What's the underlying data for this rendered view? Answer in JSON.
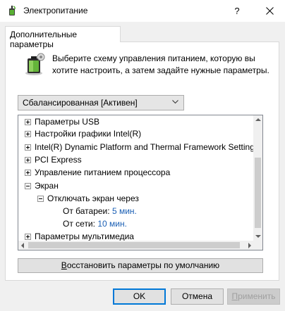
{
  "window": {
    "title": "Электропитание",
    "help_label": "?",
    "close_label": "✕",
    "icon": "power-options-icon"
  },
  "tab": {
    "label": "Дополнительные параметры"
  },
  "description": "Выберите схему управления питанием, которую вы хотите настроить, а затем задайте нужные параметры.",
  "scheme_select": {
    "selected": "Сбалансированная [Активен]"
  },
  "tree": {
    "items": [
      {
        "label": "Параметры USB",
        "expander": "plus"
      },
      {
        "label": "Настройки графики Intel(R)",
        "expander": "plus"
      },
      {
        "label": "Intel(R) Dynamic Platform and Thermal Framework Setting",
        "expander": "plus"
      },
      {
        "label": "PCI Express",
        "expander": "plus"
      },
      {
        "label": "Управление питанием процессора",
        "expander": "plus"
      },
      {
        "label": "Экран",
        "expander": "minus"
      },
      {
        "label": "Отключать экран через",
        "expander": "minus"
      },
      {
        "label": "От батареи:",
        "value": "5 мин."
      },
      {
        "label": "От сети:",
        "value": "10 мин."
      },
      {
        "label": "Параметры мультимедиа",
        "expander": "plus"
      }
    ]
  },
  "restore_button": {
    "label_underlined": "В",
    "label_rest": "осстановить параметры по умолчанию"
  },
  "buttons": {
    "ok": "OK",
    "cancel": "Отмена",
    "apply_underlined": "П",
    "apply_rest": "рименить"
  },
  "colors": {
    "value_text": "#1a5fb4",
    "dialog_bg": "#f0f0f0",
    "focus_border": "#0078d7"
  }
}
